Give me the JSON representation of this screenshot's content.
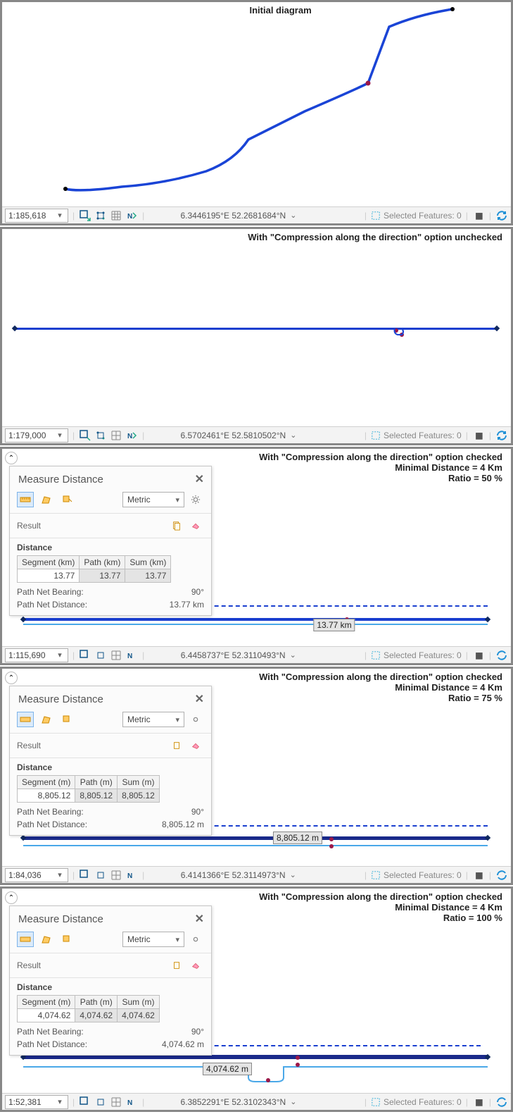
{
  "panels": [
    {
      "caption": [
        "Initial diagram"
      ],
      "scale": "1:185,618",
      "coord": "6.3446195°E 52.2681684°N",
      "selected": "Selected Features: 0"
    },
    {
      "caption": [
        "With \"Compression along the direction\" option unchecked"
      ],
      "scale": "1:179,000",
      "coord": "6.5702461°E 52.5810502°N",
      "selected": "Selected Features: 0"
    },
    {
      "caption": [
        "With \"Compression along the direction\" option checked",
        "Minimal Distance = 4 Km",
        "Ratio = 50 %"
      ],
      "scale": "1:115,690",
      "coord": "6.4458737°E 52.3110493°N",
      "selected": "Selected Features: 0",
      "measure": {
        "title": "Measure Distance",
        "units": "Metric",
        "headers": [
          "Segment (km)",
          "Path (km)",
          "Sum (km)"
        ],
        "row": [
          "13.77",
          "13.77",
          "13.77"
        ],
        "bearing_label": "Path Net Bearing:",
        "bearing": "90°",
        "dist_label": "Path Net Distance:",
        "dist": "13.77 km",
        "dim_label": "13.77 km",
        "result": "Result",
        "section": "Distance"
      }
    },
    {
      "caption": [
        "With \"Compression along the direction\" option checked",
        "Minimal Distance = 4 Km",
        "Ratio = 75 %"
      ],
      "scale": "1:84,036",
      "coord": "6.4141366°E 52.3114973°N",
      "selected": "Selected Features: 0",
      "measure": {
        "title": "Measure Distance",
        "units": "Metric",
        "headers": [
          "Segment (m)",
          "Path (m)",
          "Sum (m)"
        ],
        "row": [
          "8,805.12",
          "8,805.12",
          "8,805.12"
        ],
        "bearing_label": "Path Net Bearing:",
        "bearing": "90°",
        "dist_label": "Path Net Distance:",
        "dist": "8,805.12 m",
        "dim_label": "8,805.12 m",
        "result": "Result",
        "section": "Distance"
      }
    },
    {
      "caption": [
        "With \"Compression along the direction\" option checked",
        "Minimal Distance = 4 Km",
        "Ratio = 100 %"
      ],
      "scale": "1:52,381",
      "coord": "6.3852291°E 52.3102343°N",
      "selected": "Selected Features: 0",
      "measure": {
        "title": "Measure Distance",
        "units": "Metric",
        "headers": [
          "Segment (m)",
          "Path (m)",
          "Sum (m)"
        ],
        "row": [
          "4,074.62",
          "4,074.62",
          "4,074.62"
        ],
        "bearing_label": "Path Net Bearing:",
        "bearing": "90°",
        "dist_label": "Path Net Distance:",
        "dist": "4,074.62 m",
        "dim_label": "4,074.62 m",
        "result": "Result",
        "section": "Distance"
      }
    }
  ]
}
